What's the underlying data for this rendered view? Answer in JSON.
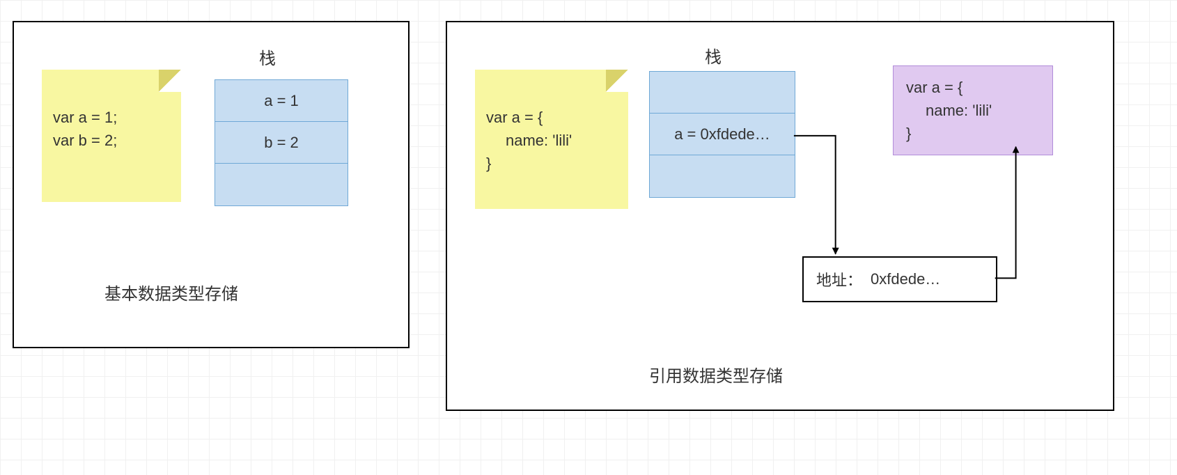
{
  "left": {
    "stack_title": "栈",
    "note_line1": "var a = 1;",
    "note_line2": "var b = 2;",
    "cell1": "a = 1",
    "cell2": "b = 2",
    "caption": "基本数据类型存储"
  },
  "right": {
    "stack_title": "栈",
    "note_line1": "var a = {",
    "note_line2": "name: 'lili'",
    "note_line3": "}",
    "cell1": "a = 0xfdede…",
    "heap_line1": "var a = {",
    "heap_line2": "name: 'lili'",
    "heap_line3": "}",
    "address_label": "地址：",
    "address_value": "0xfdede…",
    "caption": "引用数据类型存储"
  }
}
